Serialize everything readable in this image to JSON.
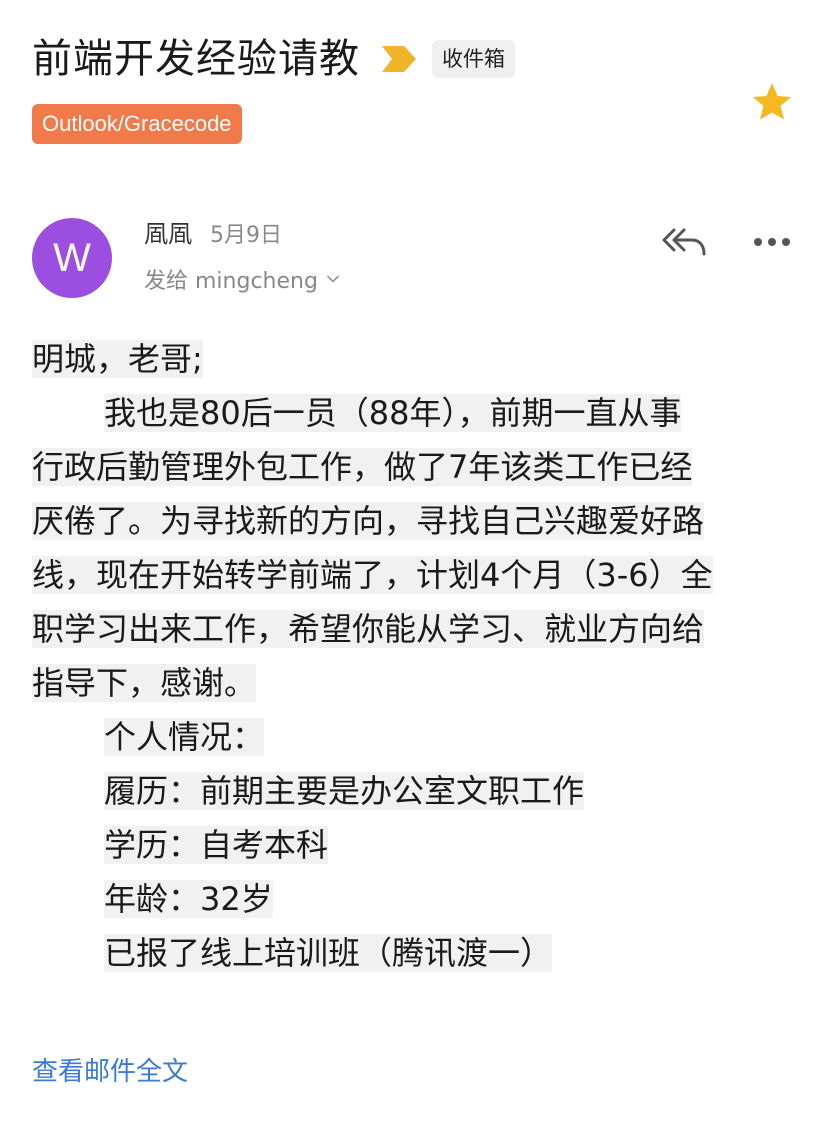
{
  "header": {
    "subject": "前端开发经验请教",
    "folder": "收件箱",
    "account": "Outlook/Gracecode",
    "starred": true,
    "colors": {
      "accent_tag": "#f07a4a",
      "star": "#f5b820",
      "arrow_tag": "#f0b429"
    }
  },
  "sender": {
    "avatar_letter": "W",
    "avatar_color": "#9b4ee0",
    "name": "凮凮",
    "date": "5月9日",
    "to_line": "发给 mingcheng"
  },
  "actions": {
    "reply_all_icon": "reply-all-icon",
    "more_icon": "more-icon"
  },
  "body": {
    "greeting": "明城，老哥;",
    "paragraph_lines": [
      "我也是80后一员（88年），前期一直从事",
      "行政后勤管理外包工作，做了7年该类工作已经",
      "厌倦了。为寻找新的方向，寻找自己兴趣爱好路",
      "线，现在开始转学前端了，计划4个月（3-6）全",
      "职学习出来工作，希望你能从学习、就业方向给",
      "指导下，感谢。"
    ],
    "personal_title": "个人情况：",
    "resume": "履历：前期主要是办公室文职工作",
    "education": "学历：自考本科",
    "age": "年龄：32岁",
    "course": "已报了线上培训班（腾讯渡一）"
  },
  "footer": {
    "view_full": "查看邮件全文"
  }
}
